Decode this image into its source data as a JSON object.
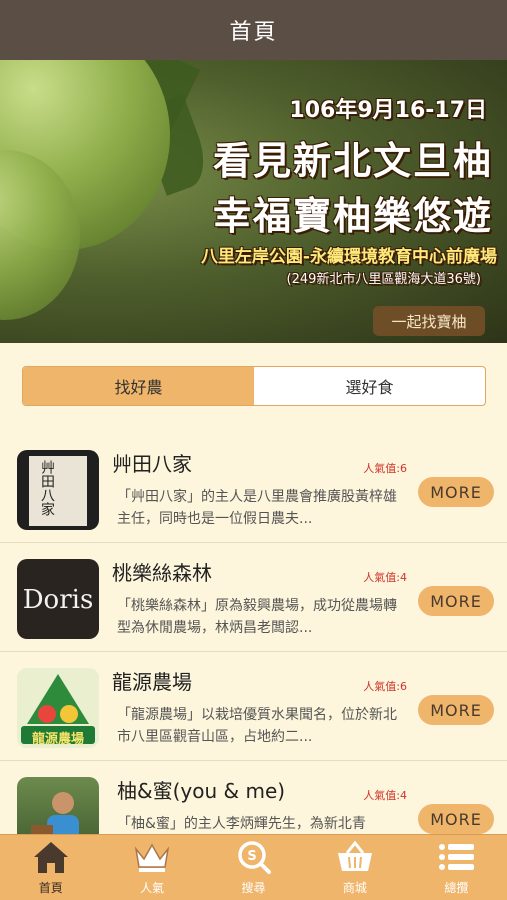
{
  "header": {
    "title": "首頁"
  },
  "banner": {
    "date": "106年9月16-17日",
    "line1": "看見新北文旦柚",
    "line2": "幸福寶柚樂悠遊",
    "venue": "八里左岸公園-永續環境教育中心前廣場",
    "address": "(249新北市八里區觀海大道36號)",
    "cta": "一起找寶柚",
    "dot_count": 12,
    "active_dot": 0
  },
  "segment": {
    "tabs": [
      {
        "label": "找好農",
        "active": true
      },
      {
        "label": "選好食",
        "active": false
      }
    ]
  },
  "farms": [
    {
      "name": "艸田八家",
      "popularity": "人氣值:6",
      "description": "「艸田八家」的主人是八里農會推廣股黃梓雄主任，同時也是一位假日農夫...",
      "more": "MORE"
    },
    {
      "name": "桃樂絲森林",
      "popularity": "人氣值:4",
      "description": "「桃樂絲森林」原為毅興農場，成功從農場轉型為休閒農場，林炳昌老闆認...",
      "more": "MORE"
    },
    {
      "name": "龍源農場",
      "popularity": "人氣值:6",
      "description": "「龍源農場」以栽培優質水果聞名，位於新北市八里區觀音山區，占地約二...",
      "more": "MORE"
    },
    {
      "name": "柚&蜜(you & me)",
      "popularity": "人氣值:4",
      "description": "「柚&蜜」的主人李炳輝先生，為新北青",
      "more": "MORE"
    }
  ],
  "thumbs": {
    "doris": "Doris",
    "longyuan": "龍源農場",
    "caotian": "艸田八家"
  },
  "tabbar": [
    {
      "label": "首頁",
      "icon": "home-icon",
      "active": true
    },
    {
      "label": "人氣",
      "icon": "crown-icon",
      "active": false
    },
    {
      "label": "搜尋",
      "icon": "search-icon",
      "active": false
    },
    {
      "label": "商城",
      "icon": "basket-icon",
      "active": false
    },
    {
      "label": "總攬",
      "icon": "menu-list-icon",
      "active": false
    }
  ],
  "colors": {
    "header": "#5b4e45",
    "accent": "#efb56b",
    "background": "#fdf6dc",
    "popularity": "#d0342c"
  }
}
